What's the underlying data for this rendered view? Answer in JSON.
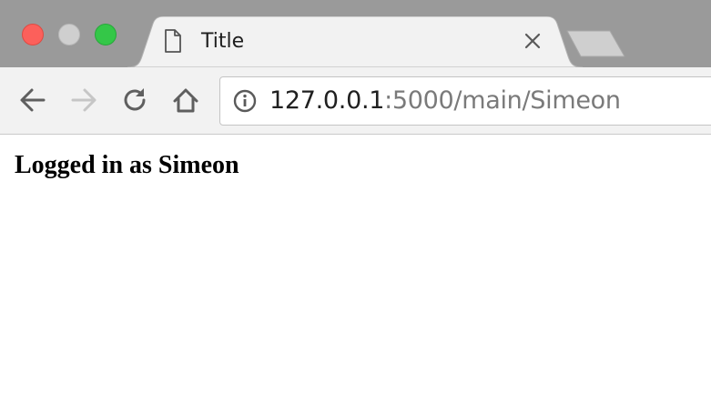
{
  "window": {
    "controls": {
      "close_color": "#fc605b",
      "minimize_color": "#cfcfcf",
      "maximize_color": "#34c748"
    }
  },
  "tab": {
    "title": "Title",
    "icon": "document-icon",
    "close_icon": "close-icon"
  },
  "toolbar": {
    "back_icon": "arrow-left-icon",
    "forward_icon": "arrow-right-icon",
    "reload_icon": "reload-icon",
    "home_icon": "home-icon"
  },
  "address_bar": {
    "info_icon": "info-icon",
    "url_host": "127.0.0.1",
    "url_rest": ":5000/main/Simeon"
  },
  "page": {
    "heading": "Logged in as Simeon"
  }
}
